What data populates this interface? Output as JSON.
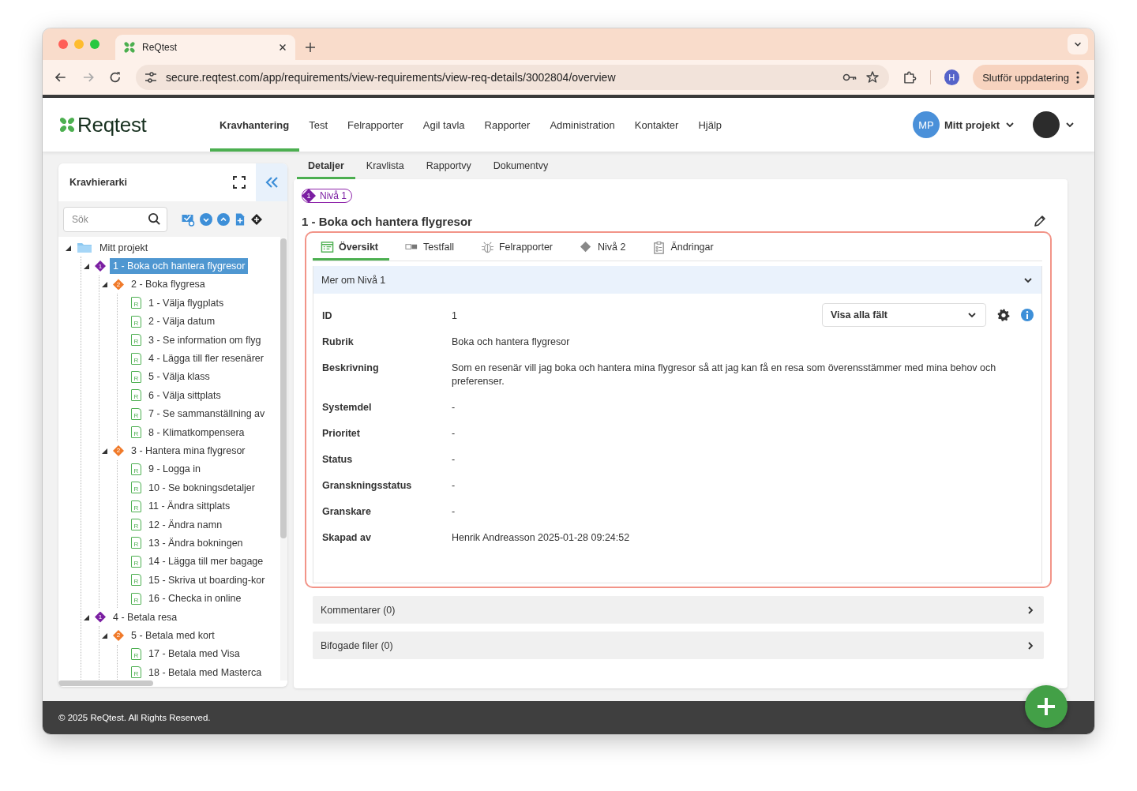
{
  "browser": {
    "tab_title": "ReQtest",
    "url": "secure.reqtest.com/app/requirements/view-requirements/view-req-details/3002804/overview",
    "profile_initial": "H",
    "update_button": "Slutför uppdatering"
  },
  "header": {
    "logo": "Reqtest",
    "nav": [
      {
        "label": "Kravhantering",
        "selected": true
      },
      {
        "label": "Test",
        "selected": false
      },
      {
        "label": "Felrapporter",
        "selected": false
      },
      {
        "label": "Agil tavla",
        "selected": false
      },
      {
        "label": "Rapporter",
        "selected": false
      },
      {
        "label": "Administration",
        "selected": false
      },
      {
        "label": "Kontakter",
        "selected": false
      },
      {
        "label": "Hjälp",
        "selected": false
      }
    ],
    "project_initials": "MP",
    "project_name": "Mitt projekt"
  },
  "tree_panel": {
    "title": "Kravhierarki",
    "search": {
      "placeholder": "Sök"
    },
    "tree": [
      {
        "label": "Mitt projekt",
        "kind": "folder",
        "selected": false,
        "expanded": true,
        "children": [
          {
            "label": "1 - Boka och hantera flygresor",
            "kind": "level1",
            "badge": "1",
            "selected": true,
            "expanded": true,
            "children": [
              {
                "label": "2 - Boka flygresa",
                "kind": "level2",
                "badge": "2",
                "selected": false,
                "expanded": true,
                "children": [
                  {
                    "label": "1 - Välja flygplats",
                    "kind": "requirement",
                    "badge": "R",
                    "selected": false
                  },
                  {
                    "label": "2 - Välja datum",
                    "kind": "requirement",
                    "badge": "R",
                    "selected": false
                  },
                  {
                    "label": "3 - Se information om flyg",
                    "kind": "requirement",
                    "badge": "R",
                    "selected": false
                  },
                  {
                    "label": "4 - Lägga till fler resenärer",
                    "kind": "requirement",
                    "badge": "R",
                    "selected": false
                  },
                  {
                    "label": "5 - Välja klass",
                    "kind": "requirement",
                    "badge": "R",
                    "selected": false
                  },
                  {
                    "label": "6 - Välja sittplats",
                    "kind": "requirement",
                    "badge": "R",
                    "selected": false
                  },
                  {
                    "label": "7 - Se sammanställning av",
                    "kind": "requirement",
                    "badge": "R",
                    "selected": false
                  },
                  {
                    "label": "8 - Klimatkompensera",
                    "kind": "requirement",
                    "badge": "R",
                    "selected": false
                  }
                ]
              },
              {
                "label": "3 - Hantera mina flygresor",
                "kind": "level2",
                "badge": "2",
                "selected": false,
                "expanded": true,
                "children": [
                  {
                    "label": "9 - Logga in",
                    "kind": "requirement",
                    "badge": "R",
                    "selected": false
                  },
                  {
                    "label": "10 - Se bokningsdetaljer",
                    "kind": "requirement",
                    "badge": "R",
                    "selected": false
                  },
                  {
                    "label": "11 - Ändra sittplats",
                    "kind": "requirement",
                    "badge": "R",
                    "selected": false
                  },
                  {
                    "label": "12 - Ändra namn",
                    "kind": "requirement",
                    "badge": "R",
                    "selected": false
                  },
                  {
                    "label": "13 - Ändra bokningen",
                    "kind": "requirement",
                    "badge": "R",
                    "selected": false
                  },
                  {
                    "label": "14 - Lägga till mer bagage",
                    "kind": "requirement",
                    "badge": "R",
                    "selected": false
                  },
                  {
                    "label": "15 - Skriva ut boarding-kor",
                    "kind": "requirement",
                    "badge": "R",
                    "selected": false
                  },
                  {
                    "label": "16 - Checka in online",
                    "kind": "requirement",
                    "badge": "R",
                    "selected": false
                  }
                ]
              }
            ]
          },
          {
            "label": "4 - Betala resa",
            "kind": "level1",
            "badge": "1",
            "selected": false,
            "expanded": true,
            "children": [
              {
                "label": "5 - Betala med kort",
                "kind": "level2",
                "badge": "2",
                "selected": false,
                "expanded": true,
                "children": [
                  {
                    "label": "17 - Betala med Visa",
                    "kind": "requirement",
                    "badge": "R",
                    "selected": false
                  },
                  {
                    "label": "18 - Betala med Masterca",
                    "kind": "requirement",
                    "badge": "R",
                    "selected": false
                  }
                ]
              }
            ]
          }
        ]
      }
    ]
  },
  "view_tabs": [
    {
      "label": "Detaljer",
      "selected": true
    },
    {
      "label": "Kravlista",
      "selected": false
    },
    {
      "label": "Rapportvy",
      "selected": false
    },
    {
      "label": "Dokumentvy",
      "selected": false
    }
  ],
  "requirement": {
    "level_badge": {
      "number": "1",
      "label": "Nivå 1"
    },
    "title": "1 - Boka och hantera flygresor",
    "tabs": [
      {
        "label": "Översikt",
        "kind": "overview",
        "selected": true
      },
      {
        "label": "Testfall",
        "kind": "testcase",
        "selected": false
      },
      {
        "label": "Felrapporter",
        "kind": "bug",
        "selected": false
      },
      {
        "label": "Nivå 2",
        "kind": "level",
        "selected": false
      },
      {
        "label": "Ändringar",
        "kind": "changes",
        "selected": false
      }
    ],
    "sections": [
      {
        "title": "Mer om Nivå 1",
        "expanded": true,
        "fields_dropdown": "Visa alla fält",
        "fields": [
          {
            "label": "ID",
            "value": "1"
          },
          {
            "label": "Rubrik",
            "value": "Boka och hantera flygresor"
          },
          {
            "label": "Beskrivning",
            "value": "Som en resenär vill jag boka och hantera mina flygresor så att jag kan få en resa som överensstämmer med mina behov och preferenser."
          },
          {
            "label": "Systemdel",
            "value": "-"
          },
          {
            "label": "Prioritet",
            "value": "-"
          },
          {
            "label": "Status",
            "value": "-"
          },
          {
            "label": "Granskningsstatus",
            "value": "-"
          },
          {
            "label": "Granskare",
            "value": "-"
          },
          {
            "label": "Skapad av",
            "value": "Henrik Andreasson 2025-01-28 09:24:52"
          }
        ]
      },
      {
        "title": "Kommentarer (0)",
        "expanded": false
      },
      {
        "title": "Bifogade filer (0)",
        "expanded": false
      }
    ]
  },
  "footer": {
    "copyright": "© 2025 ReQtest. All Rights Reserved."
  }
}
